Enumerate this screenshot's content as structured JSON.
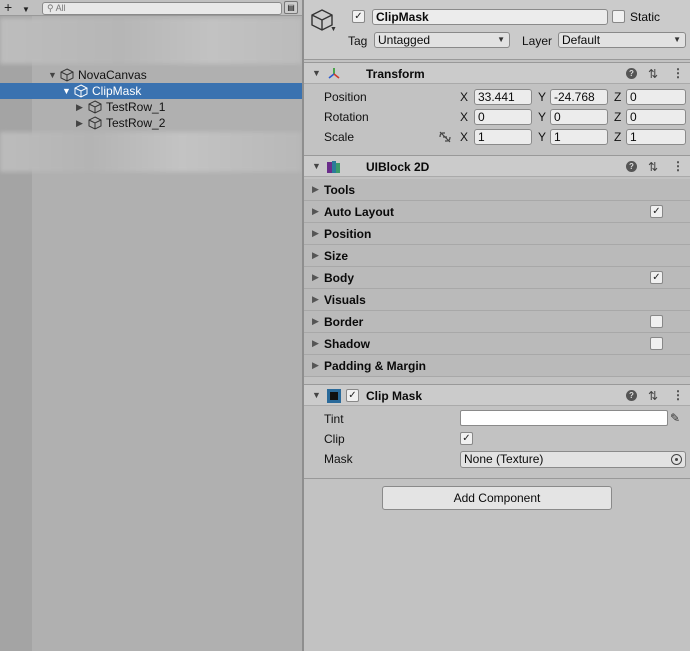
{
  "hierarchy": {
    "search_placeholder": "All",
    "plus_label": "+",
    "items": [
      {
        "label": "NovaCanvas"
      },
      {
        "label": "ClipMask"
      },
      {
        "label": "TestRow_1"
      },
      {
        "label": "TestRow_2"
      }
    ]
  },
  "inspector": {
    "object_name": "ClipMask",
    "static_label": "Static",
    "tag_label": "Tag",
    "tag_value": "Untagged",
    "layer_label": "Layer",
    "layer_value": "Default",
    "transform": {
      "title": "Transform",
      "position_label": "Position",
      "rotation_label": "Rotation",
      "scale_label": "Scale",
      "x_label": "X",
      "y_label": "Y",
      "z_label": "Z",
      "position": {
        "x": "33.441",
        "y": "-24.768",
        "z": "0"
      },
      "rotation": {
        "x": "0",
        "y": "0",
        "z": "0"
      },
      "scale": {
        "x": "1",
        "y": "1",
        "z": "1"
      }
    },
    "uiblock": {
      "title": "UIBlock 2D",
      "sections": [
        {
          "label": "Tools"
        },
        {
          "label": "Auto Layout",
          "check": "✓"
        },
        {
          "label": "Position"
        },
        {
          "label": "Size"
        },
        {
          "label": "Body",
          "check": "✓"
        },
        {
          "label": "Visuals"
        },
        {
          "label": "Border",
          "check": ""
        },
        {
          "label": "Shadow",
          "check": ""
        },
        {
          "label": "Padding & Margin"
        }
      ]
    },
    "clipmask": {
      "title": "Clip Mask",
      "tint_label": "Tint",
      "clip_label": "Clip",
      "mask_label": "Mask",
      "mask_value": "None (Texture)"
    },
    "add_component_label": "Add Component"
  },
  "colors": {
    "selection": "#3a72b0",
    "panel": "#c2c2c2"
  }
}
